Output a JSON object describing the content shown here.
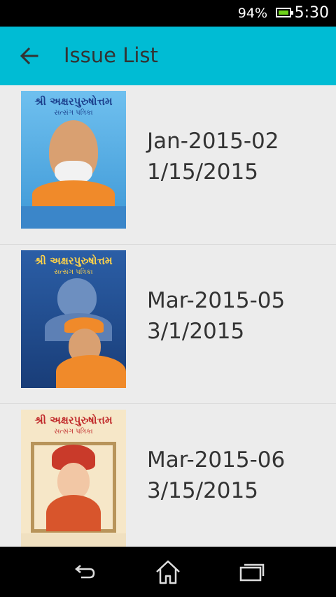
{
  "status_bar": {
    "battery_percent": "94%",
    "time": "5:30"
  },
  "app_bar": {
    "title": "Issue List",
    "back_icon": "arrow-back-icon"
  },
  "issues": [
    {
      "name": "Jan-2015-02",
      "date": "1/15/2015",
      "cover": {
        "title": "શ્રી અક્ષરપુરુષોત્તમ",
        "subtitle": "સત્સંગ પત્રિકા",
        "background": "#55aee6",
        "title_color": "#1b3f8c"
      }
    },
    {
      "name": "Mar-2015-05",
      "date": "3/1/2015",
      "cover": {
        "title": "શ્રી અક્ષરપુરુષોત્તમ",
        "subtitle": "સત્સંગ પત્રિકા",
        "background": "#1f4a8a",
        "title_color": "#ffd34a"
      }
    },
    {
      "name": "Mar-2015-06",
      "date": "3/15/2015",
      "cover": {
        "title": "શ્રી અક્ષરપુરુષોત્તમ",
        "subtitle": "સત્સંગ પત્રિકા",
        "background": "#f6e7c8",
        "title_color": "#c0292a"
      }
    }
  ],
  "nav_bar": {
    "back": "back-icon",
    "home": "home-icon",
    "recents": "recents-icon"
  }
}
